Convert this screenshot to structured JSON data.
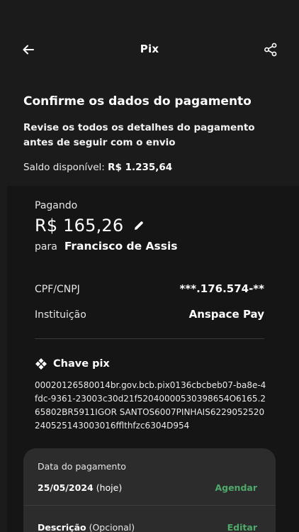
{
  "header": {
    "title": "Pix",
    "back_icon": "arrow-left-icon",
    "share_icon": "share-icon"
  },
  "intro": {
    "heading": "Confirme os dados do pagamento",
    "subtitle": "Revise os todos os detalhes do pagamento antes de seguir com o envio"
  },
  "balance": {
    "label": "Saldo disponível:",
    "value": "R$ 1.235,64"
  },
  "payment": {
    "paying_label": "Pagando",
    "amount": "R$ 165,26",
    "to_label": "para",
    "recipient": "Francisco de Assis",
    "cpf_label": "CPF/CNPJ",
    "cpf_value": "***.176.574-**",
    "institution_label": "Instituição",
    "institution_value": "Anspace Pay"
  },
  "pix": {
    "title": "Chave pix",
    "key": "00020126580014br.gov.bcb.pix0136cbcbeb07-ba8e-4fdc-9361-23003c30d21f52040000530398654O6165.265802BR5911IGOR SANTOS6007PINHAIS6229052520240525143003016fflthfzc6304D954"
  },
  "schedule": {
    "date_label": "Data do pagamento",
    "date_value": "25/05/2024",
    "date_suffix": "(hoje)",
    "schedule_link": "Agendar",
    "description_label": "Descrição",
    "description_optional": "(Opcional)",
    "edit_link": "Editar"
  },
  "colors": {
    "background": "#1b1b1b",
    "card": "#151515",
    "panel": "#2c2c2c",
    "accent_green": "#4fa96a"
  }
}
